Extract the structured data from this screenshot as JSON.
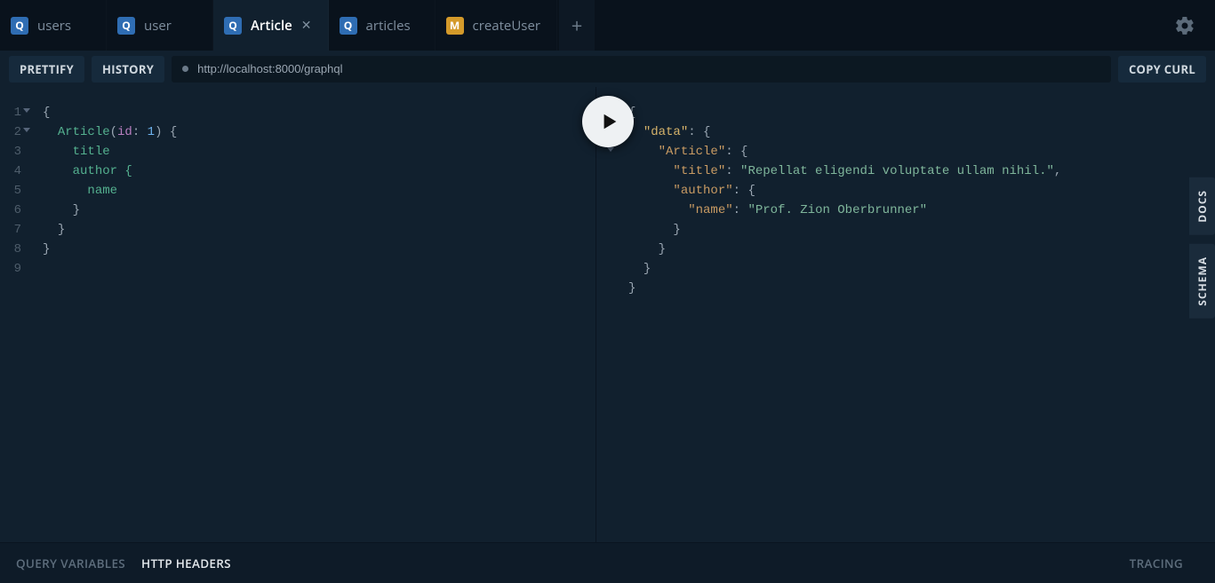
{
  "tabs": [
    {
      "badge": "Q",
      "badgeClass": "badge-q",
      "label": "users",
      "active": false
    },
    {
      "badge": "Q",
      "badgeClass": "badge-q",
      "label": "user",
      "active": false
    },
    {
      "badge": "Q",
      "badgeClass": "badge-q",
      "label": "Article",
      "active": true
    },
    {
      "badge": "Q",
      "badgeClass": "badge-q",
      "label": "articles",
      "active": false
    },
    {
      "badge": "M",
      "badgeClass": "badge-m",
      "label": "createUser",
      "active": false
    }
  ],
  "toolbar": {
    "prettify": "PRETTIFY",
    "history": "HISTORY",
    "endpoint": "http://localhost:8000/graphql",
    "copy_curl": "COPY CURL"
  },
  "query": {
    "l1": "{",
    "l2_field": "Article",
    "l2_open": "(",
    "l2_arg": "id",
    "l2_colon": ": ",
    "l2_val": "1",
    "l2_close": ") {",
    "l3": "title",
    "l4": "author {",
    "l5": "name",
    "l6": "}",
    "l7": "}",
    "l8": "}"
  },
  "response": {
    "k_data": "\"data\"",
    "k_article": "\"Article\"",
    "k_title": "\"title\"",
    "v_title": "\"Repellat eligendi voluptate ullam nihil.\"",
    "k_author": "\"author\"",
    "k_name": "\"name\"",
    "v_name": "\"Prof. Zion Oberbrunner\""
  },
  "bottom": {
    "query_vars": "QUERY VARIABLES",
    "http_headers": "HTTP HEADERS",
    "tracing": "TRACING"
  },
  "rail": {
    "docs": "DOCS",
    "schema": "SCHEMA"
  }
}
